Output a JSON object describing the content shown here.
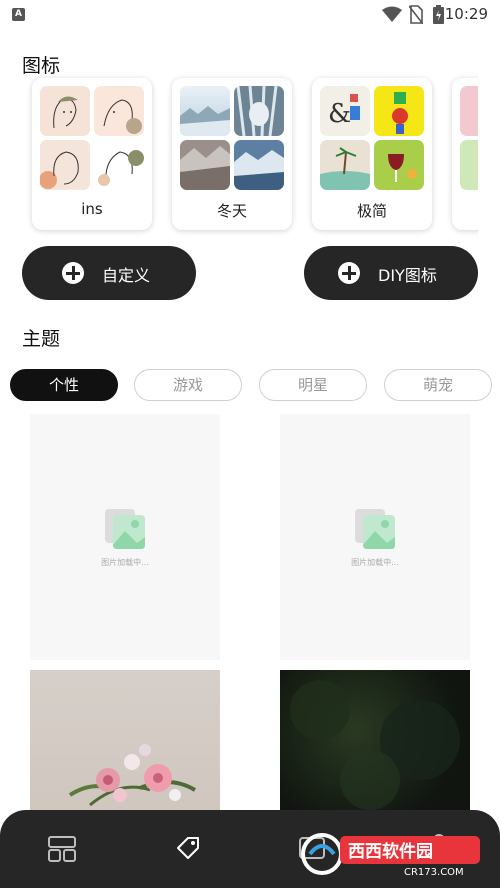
{
  "status_bar": {
    "app_badge": "A",
    "time": "10:29"
  },
  "icons_section": {
    "title": "图标",
    "packs": [
      {
        "label": "ins"
      },
      {
        "label": "冬天"
      },
      {
        "label": "极简"
      }
    ]
  },
  "actions": {
    "custom_label": "自定义",
    "diy_label": "DIY图标"
  },
  "themes_section": {
    "title": "主题",
    "chips": [
      "个性",
      "游戏",
      "明星",
      "萌宠"
    ],
    "active_chip": "个性",
    "loading_text": "图片加载中..."
  },
  "watermark": {
    "brand": "西西软件园",
    "url": "CR173.COM"
  },
  "colors": {
    "dark": "#262626",
    "accent_green": "#8fd6a8"
  }
}
